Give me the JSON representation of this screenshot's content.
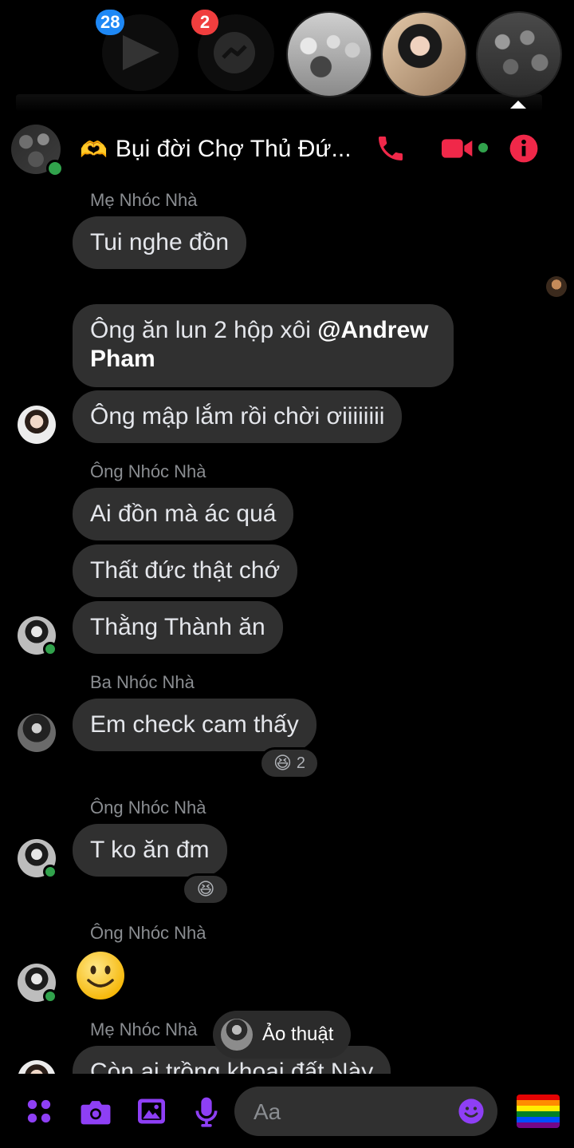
{
  "topbar": {
    "notifications": [
      {
        "app": "video-app",
        "count": "28",
        "color": "#1e88f5"
      },
      {
        "app": "messenger",
        "count": "2",
        "color": "#f03e3e"
      }
    ]
  },
  "header": {
    "title_emoji": "🫶",
    "title": "Bụi đời Chợ Thủ Đứ...",
    "accent": "#f02849"
  },
  "messages": {
    "group1": {
      "sender": "Mẹ Nhóc Nhà",
      "m1": "Tui nghe đồn",
      "m2_text": "Ông ăn lun 2 hộp xôi ",
      "m2_mention": "@Andrew Pham",
      "m3": "Ông mập lắm rồi chời ơiiiiiiii"
    },
    "group2": {
      "sender": "Ông Nhóc Nhà",
      "m1": "Ai đồn mà ác quá",
      "m2": "Thất đức thật chớ",
      "m3": "Thằng Thành ăn"
    },
    "group3": {
      "sender": "Ba Nhóc Nhà",
      "m1": "Em check cam thấy",
      "reaction_emoji": "😆",
      "reaction_count": "2"
    },
    "group4": {
      "sender": "Ông Nhóc Nhà",
      "m1": "T ko ăn đm",
      "reaction_emoji": "😆"
    },
    "group5": {
      "sender": "Ông Nhóc Nhà",
      "emoji": "🙂"
    },
    "group6": {
      "sender": "Mẹ Nhóc Nhà",
      "m1": "Còn ai trồng khoai đất Này"
    }
  },
  "tooltip": {
    "label": "Ảo thuật"
  },
  "composer": {
    "placeholder": "Aa"
  },
  "colors": {
    "icon_purple": "#8e3ff5",
    "bubble": "#303030",
    "online": "#31a24c"
  }
}
